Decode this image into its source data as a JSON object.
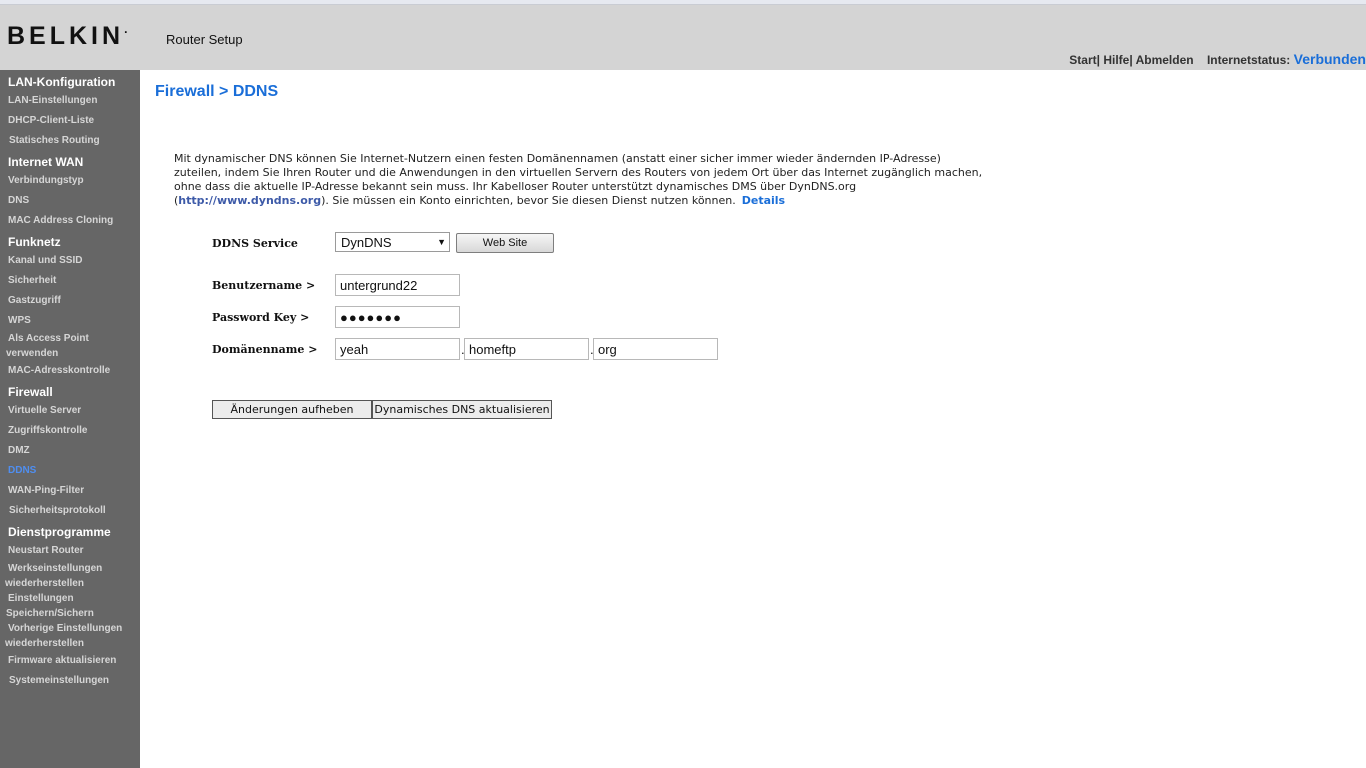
{
  "header": {
    "logo": "BELKIN",
    "logo_mark": ".",
    "title": "Router Setup",
    "links": {
      "start": "Start",
      "help": "Hilfe",
      "logout": "Abmelden",
      "sep": "|"
    },
    "status_label": "Internetstatus:",
    "status_value": "Verbunden"
  },
  "sidebar": {
    "cat_lan": "LAN-Konfiguration",
    "lan_settings": "LAN-Einstellungen",
    "dhcp": "DHCP-Client-Liste",
    "static_routing": "Statisches Routing",
    "cat_wan": "Internet WAN",
    "conn_type": "Verbindungstyp",
    "dns": "DNS",
    "mac_cloning": "MAC Address Cloning",
    "cat_wireless": "Funknetz",
    "channel_ssid": "Kanal und SSID",
    "security": "Sicherheit",
    "guest": "Gastzugriff",
    "wps": "WPS",
    "ap_line1": "Als Access Point",
    "ap_line2": "verwenden",
    "mac_control": "MAC-Adresskontrolle",
    "cat_firewall": "Firewall",
    "virtual_servers": "Virtuelle Server",
    "access_control": "Zugriffskontrolle",
    "dmz": "DMZ",
    "ddns": "DDNS",
    "wan_ping": "WAN-Ping-Filter",
    "security_log": "Sicherheitsprotokoll",
    "cat_utilities": "Dienstprogramme",
    "restart": "Neustart Router",
    "factory_line1": "Werkseinstellungen",
    "factory_line2": "wiederherstellen",
    "save_line1": "Einstellungen",
    "save_line2": "Speichern/Sichern",
    "prev_line1": "Vorherige Einstellungen",
    "prev_line2": "wiederherstellen",
    "firmware": "Firmware aktualisieren",
    "system": "Systemeinstellungen"
  },
  "main": {
    "title": "Firewall > DDNS",
    "desc_line1": "Mit dynamischer DNS können Sie Internet-Nutzern einen festen Domänennamen (anstatt einer sicher immer wieder ändernden IP-Adresse)",
    "desc_line2": "zuteilen, indem Sie Ihren Router und die Anwendungen in den virtuellen Servern des Routers von jedem Ort über das Internet zugänglich machen,",
    "desc_line3": "ohne dass die aktuelle IP-Adresse bekannt sein muss. Ihr Kabelloser Router unterstützt dynamisches DMS über DynDNS.org",
    "desc_open": "(",
    "desc_url": "http://www.dyndns.org",
    "desc_rest": "). Sie müssen ein Konto einrichten, bevor Sie diesen Dienst nutzen können.",
    "details_link": "Details",
    "ddns_service_label": "DDNS Service",
    "ddns_service_value": "DynDNS",
    "website_button": "Web Site",
    "username_label": "Benutzername >",
    "username_value": "untergrund22",
    "password_label": "Password Key >",
    "password_value": "●●●●●●●",
    "domain_label": "Domänenname >",
    "domain_part1": "yeah",
    "domain_part2": "homeftp",
    "domain_part3": "org",
    "domain_sep": ".",
    "discard_button": "Änderungen aufheben",
    "update_button": "Dynamisches DNS aktualisieren"
  },
  "colors": {
    "accent": "#1a6ed8",
    "sidebar_bg": "#666666",
    "header_bg": "#d4d4d4",
    "active_nav": "#4f8ef0"
  }
}
